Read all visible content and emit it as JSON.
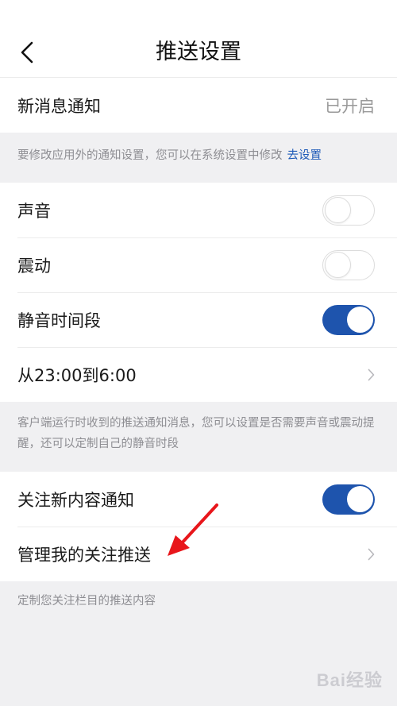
{
  "header": {
    "title": "推送设置",
    "back_icon": "chevron-left-icon"
  },
  "new_message": {
    "label": "新消息通知",
    "status": "已开启"
  },
  "system_note": {
    "text": "要修改应用外的通知设置，您可以在系统设置中修改",
    "link": "去设置"
  },
  "settings": {
    "sound": {
      "label": "声音",
      "enabled": false
    },
    "vibrate": {
      "label": "震动",
      "enabled": false
    },
    "quiet_hours": {
      "label": "静音时间段",
      "enabled": true
    },
    "quiet_range": {
      "label": "从23:00到6:00"
    }
  },
  "settings_note": "客户端运行时收到的推送通知消息，您可以设置是否需要声音或震动提醒，还可以定制自己的静音时段",
  "follow": {
    "new_content": {
      "label": "关注新内容通知",
      "enabled": true
    },
    "manage": {
      "label": "管理我的关注推送"
    }
  },
  "follow_note": "定制您关注栏目的推送内容",
  "watermark": "Bai经验",
  "colors": {
    "accent": "#1e54ad",
    "link": "#1f5bb8",
    "annotation_arrow": "#e8161b"
  }
}
